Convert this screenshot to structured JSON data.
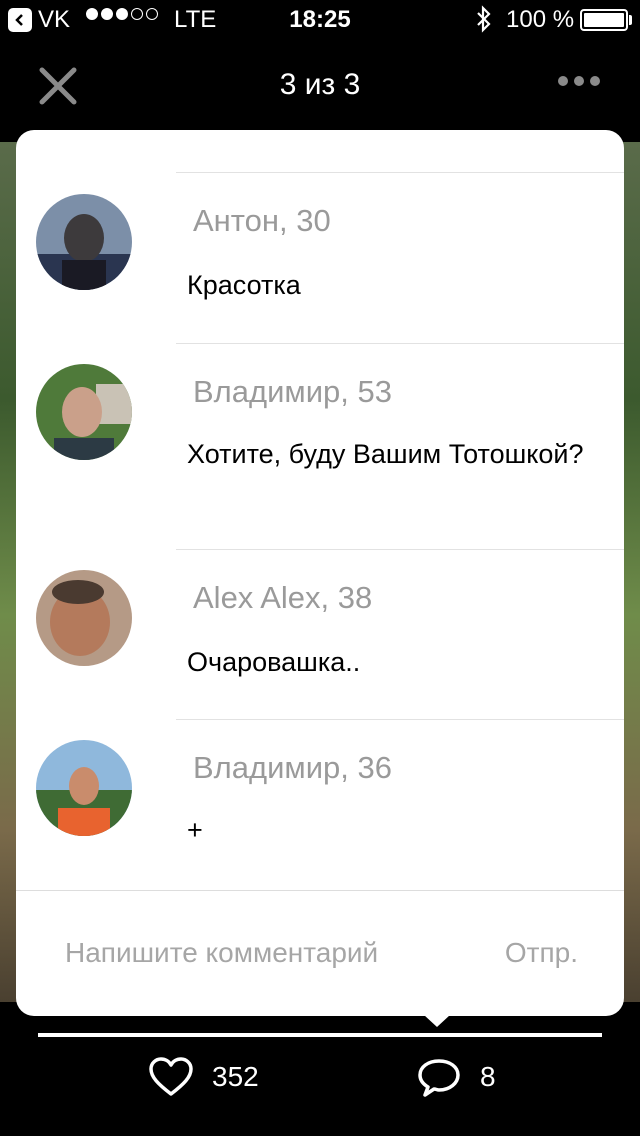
{
  "status_bar": {
    "back_app_label": "VK",
    "network": "LTE",
    "time": "18:25",
    "battery": "100 %"
  },
  "nav": {
    "title": "3 из 3"
  },
  "comments": [
    {
      "author": "Антон, 30",
      "text": "Красотка"
    },
    {
      "author": "Владимир, 53",
      "text": "Хотите, буду Вашим Тотошкой?"
    },
    {
      "author": "Alex Alex, 38",
      "text": "Очаровашка.."
    },
    {
      "author": "Владимир, 36",
      "text": "+"
    }
  ],
  "composer": {
    "placeholder": "Напишите комментарий",
    "send_label": "Отпр."
  },
  "footer": {
    "likes_count": "352",
    "comments_count": "8"
  },
  "colors": {
    "card_bg": "#ffffff",
    "muted_text": "#9a9a9a",
    "background": "#000000"
  }
}
